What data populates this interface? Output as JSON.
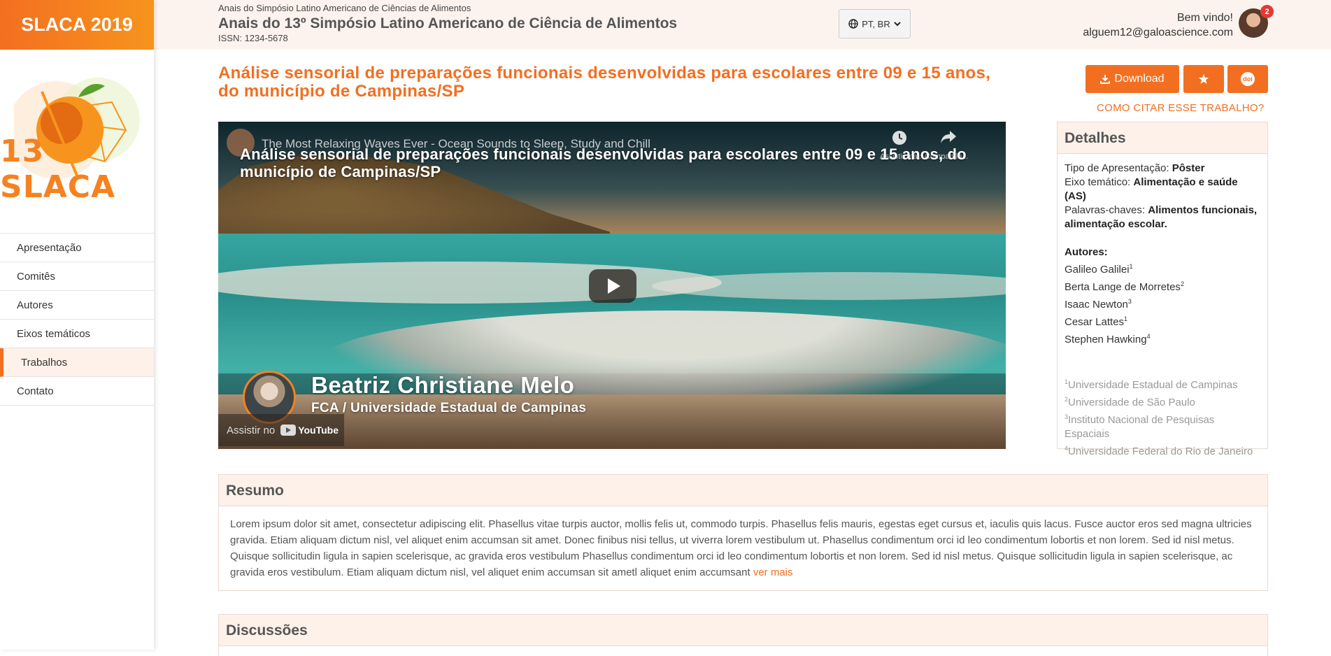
{
  "sidebar": {
    "brand": "SLACA 2019",
    "logo_text": "13 SLACA",
    "items": [
      {
        "label": "Apresentação"
      },
      {
        "label": "Comitês"
      },
      {
        "label": "Autores"
      },
      {
        "label": "Eixos temáticos"
      },
      {
        "label": "Trabalhos",
        "active": true
      },
      {
        "label": "Contato"
      }
    ]
  },
  "header": {
    "subtitle": "Anais do Simpósio Latino Americano de Ciências de Alimentos",
    "title": "Anais do 13º Simpósio Latino Americano de Ciência de Alimentos",
    "issn": "ISSN: 1234-5678",
    "language": "PT, BR",
    "welcome": "Bem vindo!",
    "email": "alguem12@galoascience.com",
    "notifications": "2"
  },
  "paper": {
    "title": "Análise sensorial de preparações funcionais desenvolvidas para escolares entre 09 e 15 anos, do município de Campinas/SP",
    "download_label": "Download",
    "doi_label": "doi",
    "cite_label": "COMO CITAR ESSE TRABALHO?"
  },
  "video": {
    "yt_title": "The Most Relaxing Waves Ever - Ocean Sounds to Sleep, Study and Chill",
    "watch_later_label": "Assistir mai...",
    "share_label": "Compartilh...",
    "overlay_title": "Análise sensorial de preparações funcionais desenvolvidas para escolares entre 09 e 15 anos, do município de Campinas/SP",
    "speaker": "Beatriz Christiane Melo",
    "affiliation": "FCA / Universidade Estadual de Campinas",
    "watch_on": "Assistir no",
    "yt_brand": "YouTube"
  },
  "details": {
    "heading": "Detalhes",
    "type_label": "Tipo de Apresentação:",
    "type_value": "Pôster",
    "axis_label": "Eixo temático:",
    "axis_value": "Alimentação e saúde (AS)",
    "keywords_label": "Palavras-chaves:",
    "keywords_value": "Alimentos funcionais, alimentação escolar.",
    "authors_label": "Autores:",
    "authors": [
      {
        "name": "Galileo Galilei",
        "sup": "1"
      },
      {
        "name": "Berta Lange de Morretes",
        "sup": "2"
      },
      {
        "name": "Isaac Newton",
        "sup": "3"
      },
      {
        "name": "Cesar Lattes",
        "sup": "1"
      },
      {
        "name": "Stephen Hawking",
        "sup": "4"
      }
    ],
    "affiliations": [
      {
        "sup": "1",
        "name": "Universidade Estadual de Campinas"
      },
      {
        "sup": "2",
        "name": "Universidade de São Paulo"
      },
      {
        "sup": "3",
        "name": "Instituto Nacional de Pesquisas Espaciais"
      },
      {
        "sup": "4",
        "name": "Universidade Federal do Rio de Janeiro"
      }
    ]
  },
  "resumo": {
    "heading": "Resumo",
    "text": "Lorem ipsum dolor sit amet, consectetur adipiscing elit. Phasellus vitae turpis auctor, mollis felis ut, commodo turpis. Phasellus felis mauris, egestas eget cursus et, iaculis quis lacus. Fusce auctor eros sed magna ultricies gravida. Etiam aliquam dictum nisl, vel aliquet enim accumsan sit amet. Donec finibus nisi tellus, ut viverra lorem vestibulum ut. Phasellus condimentum orci id leo condimentum lobortis et non lorem. Sed id nisl metus. Quisque sollicitudin ligula in sapien scelerisque, ac gravida eros vestibulum Phasellus condimentum orci id leo condimentum lobortis et non lorem. Sed id nisl metus. Quisque sollicitudin ligula in sapien scelerisque, ac gravida eros vestibulum. Etiam aliquam dictum nisl, vel aliquet enim accumsan sit ametl aliquet enim accumsant",
    "more_label": "ver mais"
  },
  "discussoes": {
    "heading": "Discussões"
  },
  "colors": {
    "accent": "#f26f21",
    "panel_bg": "#fdf1ea",
    "header_bg": "#fdf3ee"
  }
}
